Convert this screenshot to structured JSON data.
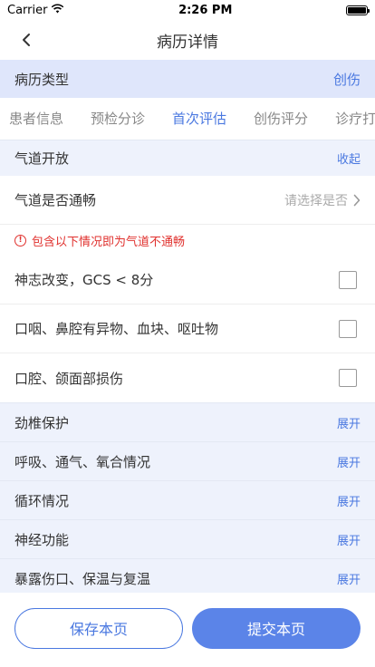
{
  "status_bar": {
    "carrier": "Carrier",
    "time": "2:26 PM"
  },
  "nav": {
    "title": "病历详情"
  },
  "record_type": {
    "label": "病历类型",
    "value": "创伤"
  },
  "tabs": [
    {
      "label": "患者信息",
      "active": false
    },
    {
      "label": "预检分诊",
      "active": false
    },
    {
      "label": "首次评估",
      "active": true
    },
    {
      "label": "创伤评分",
      "active": false
    },
    {
      "label": "诊疗打",
      "active": false
    }
  ],
  "airway": {
    "title": "气道开放",
    "action": "收起",
    "question_label": "气道是否通畅",
    "question_placeholder": "请选择是否",
    "warning": "包含以下情况即为气道不通畅",
    "options": [
      {
        "label": "神志改变，GCS < 8分",
        "checked": false
      },
      {
        "label": "口咽、鼻腔有异物、血块、呕吐物",
        "checked": false
      },
      {
        "label": "口腔、颌面部损伤",
        "checked": false
      }
    ]
  },
  "collapsed_sections": [
    {
      "title": "劲椎保护",
      "action": "展开"
    },
    {
      "title": "呼吸、通气、氧合情况",
      "action": "展开"
    },
    {
      "title": "循环情况",
      "action": "展开"
    },
    {
      "title": "神经功能",
      "action": "展开"
    },
    {
      "title": "暴露伤口、保温与复温",
      "action": "展开"
    }
  ],
  "footer": {
    "save_label": "保存本页",
    "submit_label": "提交本页"
  },
  "colors": {
    "accent": "#4a78e0",
    "warning": "#e0312e",
    "section_bg": "#eef2fc"
  }
}
